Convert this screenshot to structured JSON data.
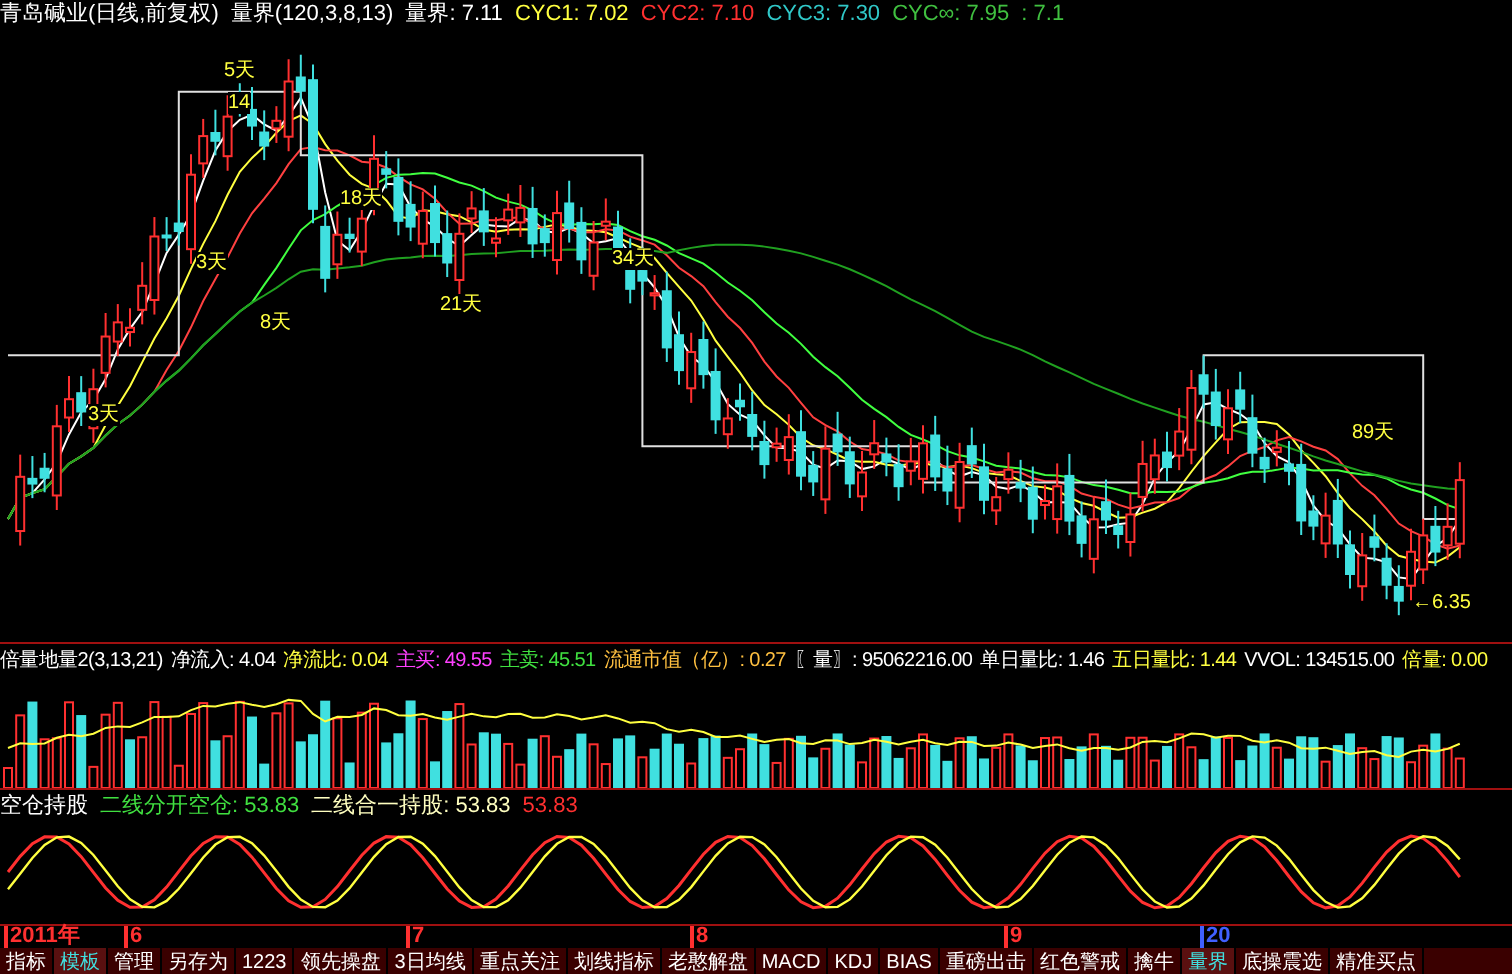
{
  "header": {
    "title": "青岛碱业(日线,前复权)",
    "indicator": "量界(120,3,8,13)",
    "values": [
      {
        "label": "量界: 7.11",
        "color": "#ffffff"
      },
      {
        "label": "CYC1: 7.02",
        "color": "#ffff40"
      },
      {
        "label": "CYC2: 7.10",
        "color": "#ff3030"
      },
      {
        "label": "CYC3: 7.30",
        "color": "#30c8c8"
      },
      {
        "label": "CYC∞: 7.95",
        "color": "#40c040"
      },
      {
        "label": ": 7.1",
        "color": "#40c040"
      }
    ]
  },
  "annotations": [
    "5天",
    "14",
    "18天",
    "3天",
    "8天",
    "21天",
    "34天",
    "3天",
    "89天",
    "←6.35"
  ],
  "volume_header": [
    {
      "label": "倍量地量2(3,13,21)",
      "color": "#ffffff"
    },
    {
      "label": "净流入: 4.04",
      "color": "#ffffff"
    },
    {
      "label": "净流比: 0.04",
      "color": "#ffff40"
    },
    {
      "label": "主买: 49.55",
      "color": "#ff40ff"
    },
    {
      "label": "主卖: 45.51",
      "color": "#40e040"
    },
    {
      "label": "流通市值（亿）: 0.27",
      "color": "#ffc040"
    },
    {
      "label": "〖量〗: 95062216.00",
      "color": "#ffffff"
    },
    {
      "label": "单日量比: 1.46",
      "color": "#ffffff"
    },
    {
      "label": "五日量比: 1.44",
      "color": "#ffff40"
    },
    {
      "label": "VVOL: 134515.00",
      "color": "#ffffff"
    },
    {
      "label": "倍量: 0.00",
      "color": "#ffff40"
    }
  ],
  "oscillator_header": [
    {
      "label": "空仓持股",
      "color": "#ffffff"
    },
    {
      "label": "二线分开空仓: 53.83",
      "color": "#40e040"
    },
    {
      "label": "二线合一持股: 53.83",
      "color": "#ffffc0"
    },
    {
      "label": "53.83",
      "color": "#ff3030"
    }
  ],
  "time_axis": [
    {
      "label": "2011年",
      "color": "#ff3030"
    },
    {
      "label": "6",
      "color": "#ff3030"
    },
    {
      "label": "7",
      "color": "#ff3030"
    },
    {
      "label": "8",
      "color": "#ff3030"
    },
    {
      "label": "9",
      "color": "#ff3030"
    },
    {
      "label": "20",
      "color": "#4060ff"
    }
  ],
  "tabs": [
    {
      "label": "指标",
      "selected": false
    },
    {
      "label": "模板",
      "selected": true
    },
    {
      "label": "管理",
      "selected": false
    },
    {
      "label": "另存为",
      "selected": false
    },
    {
      "label": "1223",
      "selected": false
    },
    {
      "label": "领先操盘",
      "selected": false
    },
    {
      "label": "3日均线",
      "selected": false
    },
    {
      "label": "重点关注",
      "selected": false
    },
    {
      "label": "划线指标",
      "selected": false
    },
    {
      "label": "老憨解盘",
      "selected": false
    },
    {
      "label": "MACD",
      "selected": false
    },
    {
      "label": "KDJ",
      "selected": false
    },
    {
      "label": "BIAS",
      "selected": false
    },
    {
      "label": "重磅出击",
      "selected": false
    },
    {
      "label": "红色警戒",
      "selected": false
    },
    {
      "label": "擒牛",
      "selected": false
    },
    {
      "label": "量界",
      "selected": true
    },
    {
      "label": "底操震选",
      "selected": false
    },
    {
      "label": "精准买点",
      "selected": false
    }
  ]
}
